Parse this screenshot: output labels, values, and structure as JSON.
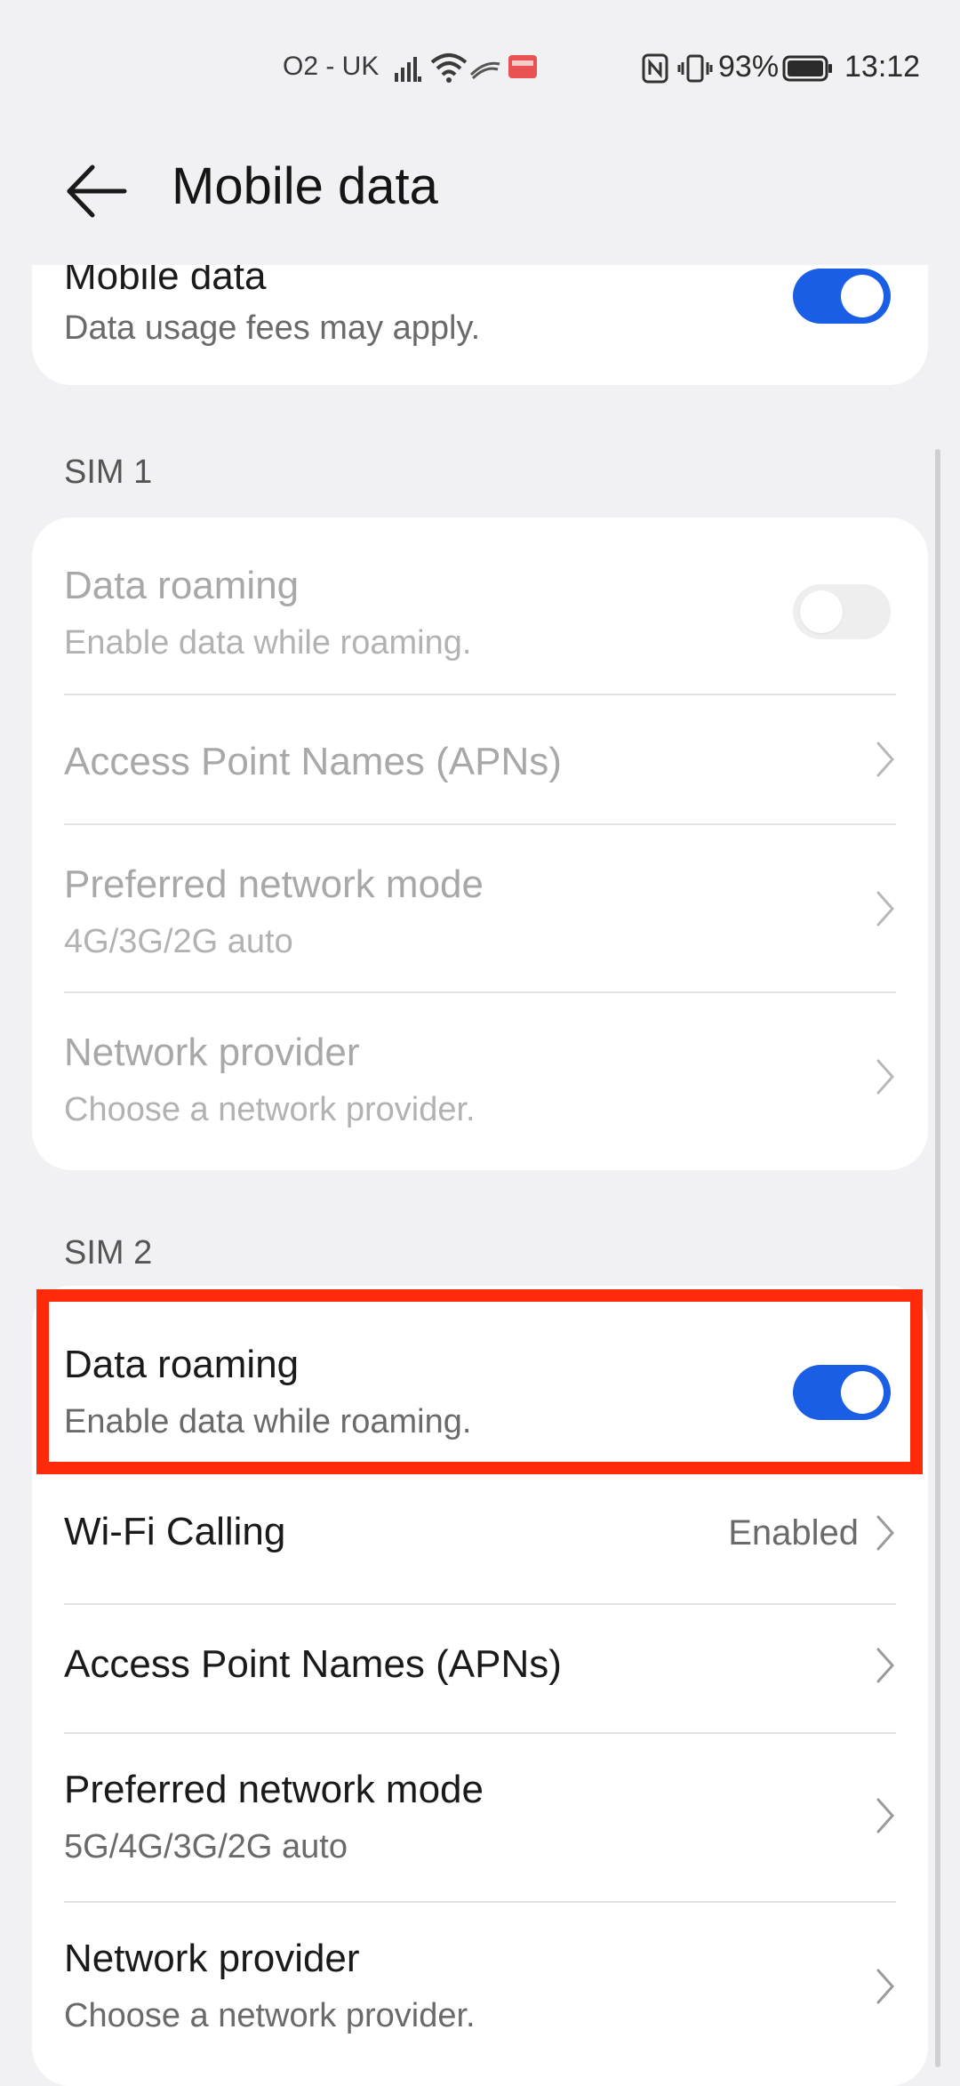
{
  "status_bar": {
    "carrier": "O2 - UK",
    "battery_percent": "93%",
    "time": "13:12",
    "icons": [
      "signal-icon",
      "wifi-icon",
      "data-activity-icon",
      "notification-icon",
      "nfc-icon",
      "vibrate-icon",
      "battery-icon"
    ]
  },
  "header": {
    "title": "Mobile data",
    "back_icon": "back-arrow-icon"
  },
  "top_card": {
    "title": "Mobile data",
    "subtitle": "Data usage fees may apply.",
    "toggle": "on"
  },
  "sim1": {
    "label": "SIM 1",
    "data_roaming": {
      "title": "Data roaming",
      "subtitle": "Enable data while roaming.",
      "toggle": "off"
    },
    "apn": {
      "title": "Access Point Names (APNs)"
    },
    "network_mode": {
      "title": "Preferred network mode",
      "subtitle": "4G/3G/2G auto"
    },
    "network_provider": {
      "title": "Network provider",
      "subtitle": "Choose a network provider."
    }
  },
  "sim2": {
    "label": "SIM 2",
    "data_roaming": {
      "title": "Data roaming",
      "subtitle": "Enable data while roaming.",
      "toggle": "on"
    },
    "wifi_calling": {
      "title": "Wi-Fi Calling",
      "value": "Enabled"
    },
    "apn": {
      "title": "Access Point Names (APNs)"
    },
    "network_mode": {
      "title": "Preferred network mode",
      "subtitle": "5G/4G/3G/2G auto"
    },
    "network_provider": {
      "title": "Network provider",
      "subtitle": "Choose a network provider."
    }
  },
  "colors": {
    "accent": "#1a5ee6",
    "highlight": "#ff2a0a",
    "background": "#f1f1f3"
  }
}
